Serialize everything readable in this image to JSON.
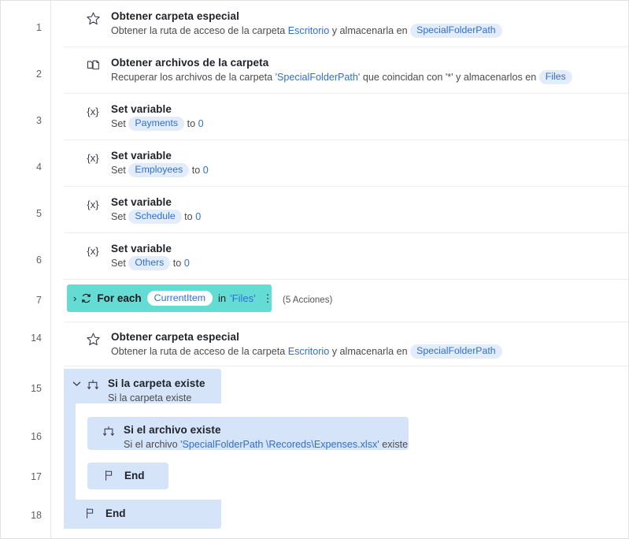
{
  "window": {
    "title": "Flow designer actions list"
  },
  "gutter": {
    "numbers": [
      "1",
      "2",
      "3",
      "4",
      "5",
      "6",
      "7",
      "14",
      "15",
      "16",
      "17",
      "18"
    ]
  },
  "colors": {
    "loop_highlight": "#64dcd3",
    "block_blue": "#d6e4fa",
    "pill_blue_bg": "#e3ecfb",
    "link_blue": "#2f6fd0",
    "title_text": "#20232a",
    "subtitle_text": "#4b4b4b",
    "gutter_text": "#616161"
  },
  "steps": [
    {
      "index": "1",
      "icon": "star-icon",
      "title": "Obtener carpeta especial",
      "subtitle_parts": [
        {
          "type": "text",
          "text": "Obtener la ruta de acceso de la carpeta "
        },
        {
          "type": "link",
          "text": "Escritorio"
        },
        {
          "type": "text",
          "text": " y almacenarla en "
        },
        {
          "type": "pill",
          "text": "SpecialFolderPath"
        }
      ]
    },
    {
      "index": "2",
      "icon": "copy-files-icon",
      "title": "Obtener archivos de la carpeta",
      "subtitle_parts": [
        {
          "type": "text",
          "text": "Recuperar los archivos de la carpeta "
        },
        {
          "type": "link",
          "text": "'SpecialFolderPath'"
        },
        {
          "type": "text",
          "text": " que coincidan con '*' y almacenarlos en "
        },
        {
          "type": "pill",
          "text": "Files"
        }
      ]
    },
    {
      "index": "3",
      "icon": "variable-icon",
      "icon_glyph": "{x}",
      "title": "Set variable",
      "subtitle_parts": [
        {
          "type": "text",
          "text": "Set "
        },
        {
          "type": "pill",
          "text": "Payments"
        },
        {
          "type": "text",
          "text": " to "
        },
        {
          "type": "num",
          "text": "0"
        }
      ]
    },
    {
      "index": "4",
      "icon": "variable-icon",
      "icon_glyph": "{x}",
      "title": "Set variable",
      "subtitle_parts": [
        {
          "type": "text",
          "text": "Set "
        },
        {
          "type": "pill",
          "text": "Employees"
        },
        {
          "type": "text",
          "text": " to "
        },
        {
          "type": "num",
          "text": "0"
        }
      ]
    },
    {
      "index": "5",
      "icon": "variable-icon",
      "icon_glyph": "{x}",
      "title": "Set variable",
      "subtitle_parts": [
        {
          "type": "text",
          "text": "Set "
        },
        {
          "type": "pill",
          "text": "Schedule"
        },
        {
          "type": "text",
          "text": " to "
        },
        {
          "type": "num",
          "text": "0"
        }
      ]
    },
    {
      "index": "6",
      "icon": "variable-icon",
      "icon_glyph": "{x}",
      "title": "Set variable",
      "subtitle_parts": [
        {
          "type": "text",
          "text": "Set "
        },
        {
          "type": "pill",
          "text": "Others"
        },
        {
          "type": "text",
          "text": " to "
        },
        {
          "type": "num",
          "text": "0"
        }
      ]
    }
  ],
  "loop": {
    "index": "7",
    "chevron": "›",
    "icon": "loop-icon",
    "title": "For each",
    "variable": "CurrentItem",
    "in_word": "in",
    "collection": "'Files'",
    "kebab": "⋮",
    "count_label": "(5 Acciones)"
  },
  "step14": {
    "index": "14",
    "icon": "star-icon",
    "title": "Obtener carpeta especial",
    "subtitle_parts": [
      {
        "type": "text",
        "text": "Obtener la ruta de acceso de la carpeta "
      },
      {
        "type": "link",
        "text": "Escritorio"
      },
      {
        "type": "text",
        "text": " y almacenarla en "
      },
      {
        "type": "pill",
        "text": "SpecialFolderPath"
      }
    ]
  },
  "step15": {
    "index": "15",
    "chevron": "⌄",
    "icon": "condition-icon",
    "title": "Si la carpeta existe",
    "subtitle": "Si la carpeta existe"
  },
  "step16": {
    "index": "16",
    "icon": "condition-icon",
    "title": "Si el archivo existe",
    "subtitle_parts": [
      {
        "type": "text",
        "text": "Si el archivo "
      },
      {
        "type": "link",
        "text": "'SpecialFolderPath \\Recoreds\\Expenses.xlsx'"
      },
      {
        "type": "text",
        "text": " existe"
      }
    ]
  },
  "step17": {
    "index": "17",
    "icon": "flag-icon",
    "title": "End"
  },
  "step18": {
    "index": "18",
    "icon": "flag-icon",
    "title": "End"
  }
}
